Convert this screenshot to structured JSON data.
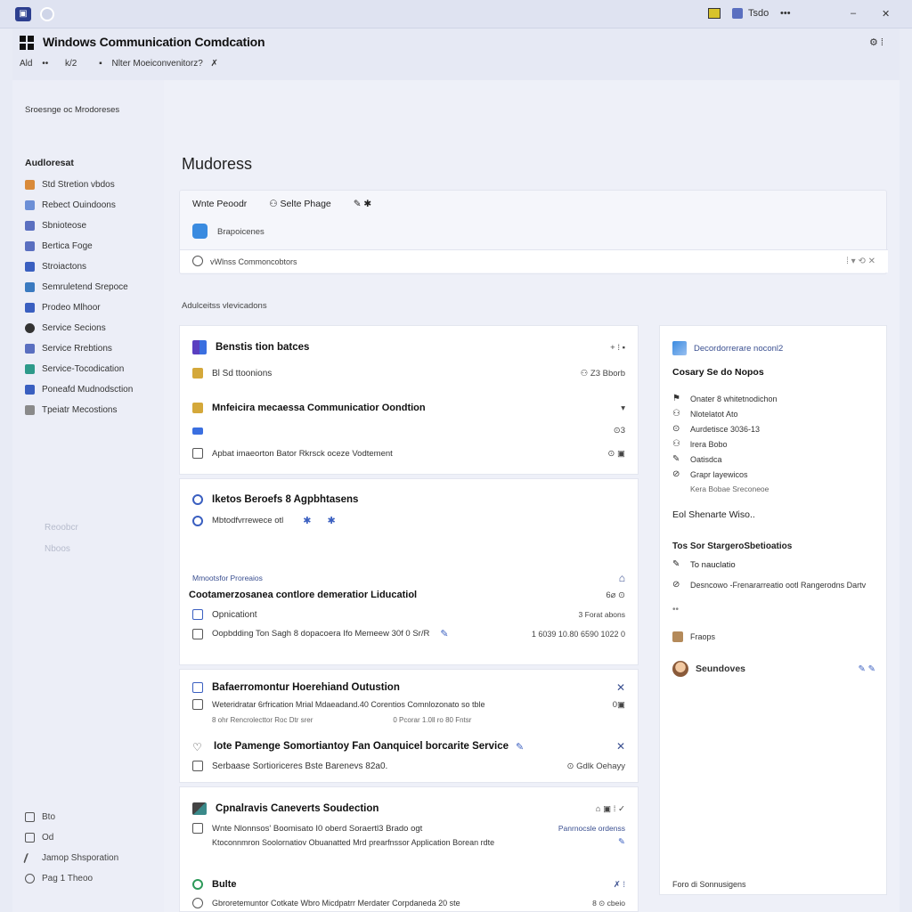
{
  "topbar": {
    "app_initial": "▣",
    "right_text": "Tsdo",
    "dots": "•••",
    "close": "✕"
  },
  "titlebar": {
    "title": "Windows Communication Comdcation",
    "sub": [
      "Ald",
      "••",
      "k/2",
      "▪",
      "Nlter Moeiconvenitorz?",
      "✗"
    ],
    "right_icons": "⚙  ⁞"
  },
  "sidebar": {
    "header": "Sroesnge oc Mrodoreses",
    "section": "Audloresat",
    "items": [
      {
        "label": "Std Stretion vbdos",
        "color": "#d98a3a"
      },
      {
        "label": "Rebect Ouindoons",
        "color": "#6c8fd6"
      },
      {
        "label": "Sbnioteose",
        "color": "#5a6fc0"
      },
      {
        "label": "Bertica Foge",
        "color": "#5a6fc0"
      },
      {
        "label": "Stroiactons",
        "color": "#3a5fc0"
      },
      {
        "label": "Semruletend Srepoce",
        "color": "#3a7ac0"
      },
      {
        "label": "Prodeo Mlhoor",
        "color": "#3a5fc0"
      },
      {
        "label": "Service Secions",
        "color": "#333333"
      },
      {
        "label": "Service Rrebtions",
        "color": "#5a6fc0"
      },
      {
        "label": "Service-Tocodication",
        "color": "#2e9a8a"
      },
      {
        "label": "Poneafd Mudnodsction",
        "color": "#3a5fc0"
      },
      {
        "label": "Tpeiatr Mecostions",
        "color": "#8a8a8a"
      }
    ],
    "faded": [
      "Reoobcr",
      "Nboos"
    ],
    "bottom": [
      "Bto",
      "Od",
      "Jamop Shsporation",
      "Pag 1 Theoo"
    ]
  },
  "main": {
    "page_title": "Mudoress",
    "toolbar": {
      "items": [
        "Wnte Peoodr",
        "⚇ Selte Phage",
        "✎ ✱"
      ],
      "row2": "Brapoicenes",
      "search": "vWlnss Commoncobtors",
      "search_right": "⁞ ▾ ⟲ ✕"
    },
    "section_label": "Adulceitss vlevicadons",
    "card1": {
      "title": "Benstis tion batces",
      "title_right": "+ ⁞ ▪",
      "sub": "Bl Sd ttoonions",
      "sub_right": "⚇ Z3 Bborb",
      "row2": "Mnfeicira mecaessa Communicatior Oondtion",
      "row2_right": "▾",
      "row3_right": "⊙3",
      "row4": "Apbat imaeorton Bator Rkrsck oceze Vodtement",
      "row4_right": "⊙ ▣"
    },
    "card2": {
      "title": "Iketos Beroefs 8 Agpbhtasens",
      "sub": "Mbtodfvrrewece otl",
      "label": "Mmootsfor Proreaios",
      "label_right": "⌂",
      "heading": "Cootamerzosanea contlore demeratior Liducatiol",
      "heading_right": "6⌀ ⊙",
      "line1": "Opnicationt",
      "line1_right": "3 Forat abons",
      "line2": "Oopbdding Ton Sagh 8 dopacoera Ifo Memeew 30f 0 Sr/R",
      "line2_right": "1 6039 10.80 6590 1022 0"
    },
    "card3": {
      "title": "Bafaerromontur Hoerehiand Outustion",
      "title_right": "✕",
      "line1": "Weteridratar 6rfrication Mrial Mdaeadand.40 Corentios Comnlozonato so tble",
      "line1_right": "0▣",
      "line2": "8 ohr Rencrolecttor Roc Dtr srer",
      "line2_right": "0 Pcorar 1.0ll ro 80 Fntsr",
      "title2": "Iote Pamenge Somortiantoy Fan Oanquicel borcarite Service",
      "title2_right": "✕",
      "line3": "Serbaase Sortioriceres Bste Barenevs 82a0.",
      "line3_right": "⊙ Gdlk Oehayy"
    },
    "card4": {
      "title": "Cpnalravis Caneverts Soudection",
      "title_right": "⌂ ▣ ⁞ ✓",
      "line1": "Wnte Nlonnsos' Boomisato I0 oberd Soraertl3 Brado ogt",
      "line1_right": "Panrnocsle ordenss",
      "line2": "Ktoconnmron Soolornatiov Obuanatted Mrd prearfnssor Application Borean rdte",
      "title2": "Bulte",
      "title2_right": "✗ ⁞",
      "line3": "Gbroretemuntor Cotkate Wbro Micdpatrr Merdater Corpdaneda 20 ste",
      "line3_right": "8 ⊙ cbeio"
    },
    "right_panel": {
      "header": "Decordorrerare noconl2",
      "title": "Cosary Se do Nopos",
      "list": [
        "Onater 8 whitetnodichon",
        "Nlotelatot Ato",
        "Aurdetisce 3036-13",
        "lrera Bobo",
        "Oatisdca",
        "Grapr layewicos",
        "Kera Bobae Sreconeoe"
      ],
      "section2": "Eol Shenarte Wiso..",
      "title2": "Tos Sor StargeroSbetioatios",
      "item2": "To nauclatio",
      "line2": "Desncowo -Frenararreatio ootl Rangerodns Dartv",
      "dots": "••",
      "item3": "Fraops",
      "avatar_name": "Seundoves",
      "avatar_right": "✎ ✎",
      "footer": "Foro di Sonnusigens"
    }
  }
}
